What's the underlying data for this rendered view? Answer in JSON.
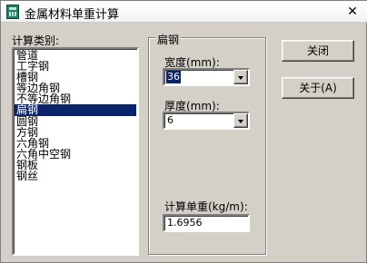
{
  "window": {
    "title": "金属材料单重计算",
    "close_glyph": "✕"
  },
  "category": {
    "label": "计算类别:",
    "items": [
      "管道",
      "工字钢",
      "槽钢",
      "等边角钢",
      "不等边角钢",
      "扁钢",
      "圆钢",
      "方钢",
      "六角钢",
      "六角中空钢",
      "钢板",
      "钢丝"
    ],
    "selected_index": 5
  },
  "group": {
    "title": "扁钢",
    "width_label": "宽度(mm):",
    "width_value": "36",
    "thickness_label": "厚度(mm):",
    "thickness_value": "6",
    "result_label": "计算单重(kg/m):",
    "result_value": "1.6956"
  },
  "buttons": {
    "close": "关闭",
    "about": "关于(A)"
  },
  "colors": {
    "selection": "#0a246a",
    "face": "#d4d0c8"
  }
}
